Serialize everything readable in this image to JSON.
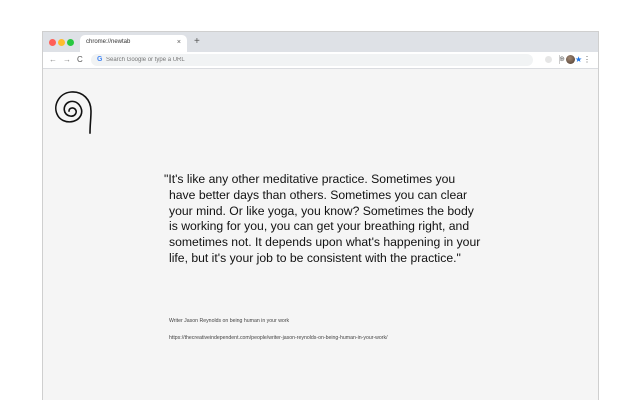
{
  "browser": {
    "tab": {
      "title": "chrome://newtab",
      "close_glyph": "×"
    },
    "new_tab_glyph": "+",
    "nav": {
      "back_glyph": "←",
      "forward_glyph": "→",
      "reload_glyph": "C"
    },
    "omnibox": {
      "engine_glyph": "G",
      "placeholder": "Search Google or type a URL",
      "value": ""
    },
    "icons": {
      "zoom": "zoom-icon",
      "bookmark": "star-icon",
      "extension": "extension-icon",
      "profile": "avatar",
      "menu": "kebab-menu-icon"
    },
    "menu_glyph": "⋮",
    "star_glyph": "★",
    "zoom_glyph": "⊕"
  },
  "page": {
    "quote": "\"It's like any other meditative practice. Sometimes you have better days than others. Sometimes you can clear your mind. Or like yoga, you know? Sometimes the body is working for you, you can get your breathing right, and sometimes not. It depends upon what's happening in your life, but it's your job to be consistent with the practice.\"",
    "attribution": "Writer Jason Reynolds on being human in your work",
    "source_url": "https://thecreativeindependent.com/people/writer-jason-reynolds-on-being-human-in-your-work/"
  },
  "colors": {
    "tabstrip": "#dee1e6",
    "page_background": "#f5f5f5",
    "accent_star": "#1a73e8",
    "close_red": "#ff5f57",
    "minimize_yellow": "#febc2e",
    "maximize_green": "#28c840"
  }
}
